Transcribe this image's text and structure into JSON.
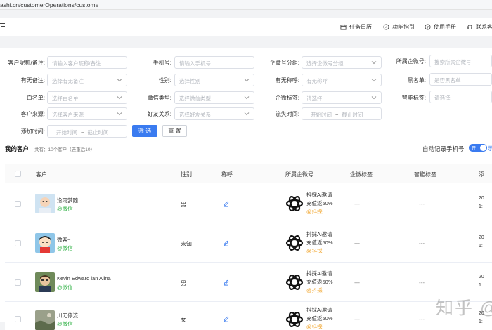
{
  "browser": {
    "url": "ashi.cn/customerOperations/custome"
  },
  "header": {
    "items": [
      {
        "label": "任务日历",
        "icon": "calendar-icon"
      },
      {
        "label": "功能指引",
        "icon": "compass-icon"
      },
      {
        "label": "使用手册",
        "icon": "help-icon"
      },
      {
        "label": "联系客",
        "icon": "headset-icon"
      }
    ]
  },
  "filters": {
    "nickname": {
      "label": "客户昵称/备注:",
      "placeholder": "请输入客户昵称/备注"
    },
    "phone": {
      "label": "手机号:",
      "placeholder": "请输入手机号"
    },
    "wecom_group": {
      "label": "企微号分组:",
      "placeholder": "选择企微号分组"
    },
    "wecom_account": {
      "label": "所属企微号:",
      "placeholder": "搜索所属企微号"
    },
    "has_remark": {
      "label": "有无备注:",
      "placeholder": "选择有无备注"
    },
    "gender": {
      "label": "性别:",
      "placeholder": "选择性别"
    },
    "has_title": {
      "label": "有无称呼:",
      "placeholder": "有无称呼"
    },
    "blacklist": {
      "label": "黑名单:",
      "placeholder": "是否黑名单"
    },
    "whitelist": {
      "label": "白名单:",
      "placeholder": "选择白名单"
    },
    "wechat_type": {
      "label": "微信类型:",
      "placeholder": "选择微信类型"
    },
    "wecom_tag": {
      "label": "企微标签:",
      "placeholder": "请选择:"
    },
    "smart_tag": {
      "label": "智能标签:",
      "placeholder": "请选择:"
    },
    "source": {
      "label": "客户来源:",
      "placeholder": "选择客户来源"
    },
    "friend": {
      "label": "好友关系:",
      "placeholder": "选择好友关系"
    },
    "churn_time": {
      "label": "流失时间:",
      "start": "开始时间",
      "sep": "~",
      "end": "截止时间"
    },
    "add_time": {
      "label": "添加时间:",
      "start": "开始时间",
      "sep": "~",
      "end": "截止时间"
    },
    "search_btn": "筛 选",
    "reset_btn": "重 置"
  },
  "list": {
    "title": "我的客户",
    "count": "共有：10个客户（去重后10）",
    "auto_record": "自动记录手机号",
    "toggle_text": "开",
    "toggle_tail": "示",
    "columns": [
      "客户",
      "性别",
      "称呼",
      "所属企微号",
      "企微标签",
      "智能标签",
      "添"
    ]
  },
  "customers": [
    {
      "name": "逸雨梦随",
      "source": "@微信",
      "gender": "男",
      "corp_line1": "抖採Ai邀请",
      "corp_line2": "充值返50%",
      "corp_tag": "@抖採",
      "wecom_tag": "---",
      "smart_tag": "---",
      "cut1": "20",
      "cut2": "1:"
    },
    {
      "name": "微客~",
      "source": "@微信",
      "gender": "未知",
      "corp_line1": "抖採Ai邀请",
      "corp_line2": "充值返50%",
      "corp_tag": "@抖採",
      "wecom_tag": "---",
      "smart_tag": "---",
      "cut1": "20",
      "cut2": "1:"
    },
    {
      "name": "Kevin Edward lan Alina",
      "source": "@微信",
      "gender": "男",
      "corp_line1": "抖採Ai邀请",
      "corp_line2": "充值返50%",
      "corp_tag": "@抖採",
      "wecom_tag": "---",
      "smart_tag": "---",
      "cut1": "20",
      "cut2": "1:"
    },
    {
      "name": "川无停流",
      "source": "@微信",
      "gender": "女",
      "corp_line1": "抖採Ai邀请",
      "corp_line2": "充值返50%",
      "corp_tag": "@抖採",
      "wecom_tag": "---",
      "smart_tag": "---",
      "cut1": "20",
      "cut2": "1:"
    }
  ],
  "watermark": "知乎 @",
  "colors": {
    "primary": "#3a7bf0",
    "wechat_green": "#35b34a",
    "tag_orange": "#f0a020"
  }
}
